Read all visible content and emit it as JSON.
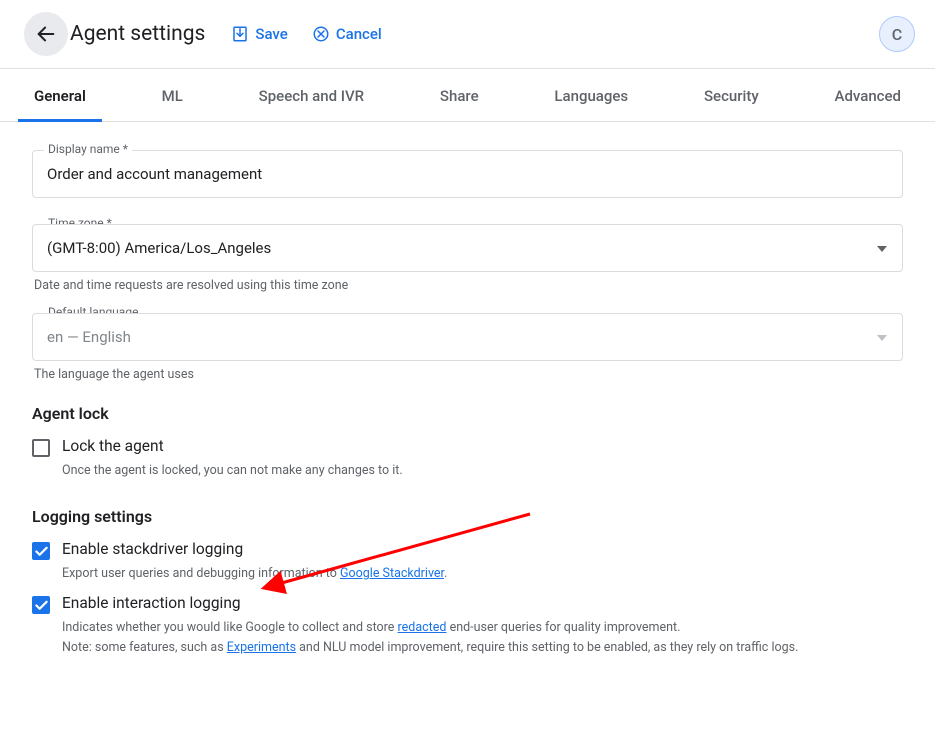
{
  "header": {
    "title": "Agent settings",
    "save_label": "Save",
    "cancel_label": "Cancel",
    "avatar_initial": "C"
  },
  "tabs": {
    "items": [
      {
        "label": "General",
        "active": true
      },
      {
        "label": "ML",
        "active": false
      },
      {
        "label": "Speech and IVR",
        "active": false
      },
      {
        "label": "Share",
        "active": false
      },
      {
        "label": "Languages",
        "active": false
      },
      {
        "label": "Security",
        "active": false
      },
      {
        "label": "Advanced",
        "active": false
      }
    ]
  },
  "form": {
    "display_name": {
      "label": "Display name *",
      "value": "Order and account management"
    },
    "time_zone": {
      "label": "Time zone *",
      "value": "(GMT-8:00) America/Los_Angeles",
      "helper": "Date and time requests are resolved using this time zone"
    },
    "default_language": {
      "label": "Default language",
      "value": "en — English",
      "helper": "The language the agent uses"
    }
  },
  "agent_lock": {
    "title": "Agent lock",
    "lock": {
      "label": "Lock the agent",
      "checked": false,
      "description": "Once the agent is locked, you can not make any changes to it."
    }
  },
  "logging": {
    "title": "Logging settings",
    "stackdriver": {
      "label": "Enable stackdriver logging",
      "checked": true,
      "desc_pre": "Export user queries and debugging information to ",
      "link_text": "Google Stackdriver",
      "desc_post": "."
    },
    "interaction": {
      "label": "Enable interaction logging",
      "checked": true,
      "desc_pre": "Indicates whether you would like Google to collect and store ",
      "link_text": "redacted",
      "desc_post": " end-user queries for quality improvement.",
      "note_pre": "Note: some features, such as ",
      "note_link": "Experiments",
      "note_post": " and NLU model improvement, require this setting to be enabled, as they rely on traffic logs."
    }
  },
  "annotation": {
    "arrow_color": "#ff0000"
  }
}
